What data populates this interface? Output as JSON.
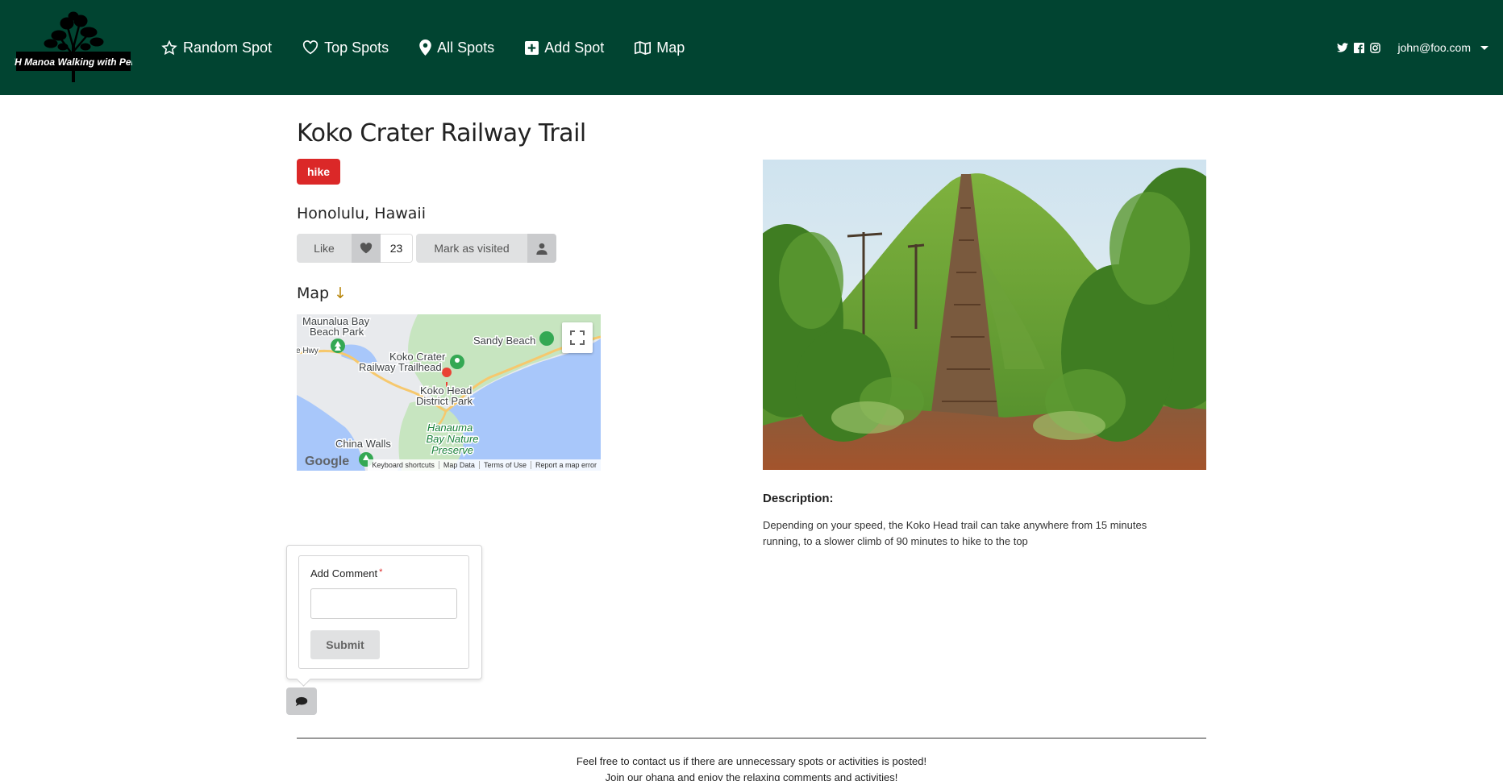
{
  "brand": {
    "logo_text": "UH Manoa Walking with Pele"
  },
  "nav": {
    "items": [
      {
        "label": "Random Spot",
        "icon": "star-icon"
      },
      {
        "label": "Top Spots",
        "icon": "heart-icon"
      },
      {
        "label": "All Spots",
        "icon": "map-marker-icon"
      },
      {
        "label": "Add Spot",
        "icon": "plus-square-icon"
      },
      {
        "label": "Map",
        "icon": "map-icon"
      }
    ],
    "social": [
      "twitter-icon",
      "facebook-icon",
      "instagram-icon"
    ],
    "user_email": "john@foo.com"
  },
  "spot": {
    "title": "Koko Crater Railway Trail",
    "tag": "hike",
    "location": "Honolulu, Hawaii",
    "like_label": "Like",
    "like_count": "23",
    "visit_label": "Mark as visited",
    "map_heading": "Map",
    "map_heading_arrow": "↓",
    "description_label": "Description:",
    "description": "Depending on your speed, the Koko Head trail can take anywhere from 15 minutes running, to a slower climb of 90 minutes to hike to the top"
  },
  "map": {
    "labels": {
      "maunalua": "Maunalua Bay",
      "maunalua2": "Beach Park",
      "sandy": "Sandy Beach",
      "koko_trail1": "Koko Crater",
      "koko_trail2": "Railway Trailhead",
      "koko_head1": "Koko Head",
      "koko_head2": "District Park",
      "hanauma1": "Hanauma",
      "hanauma2": "Bay Nature",
      "hanauma3": "Preserve",
      "china": "China Walls",
      "hwy": "e Hwy"
    },
    "google": "Google",
    "footer": [
      "Keyboard shortcuts",
      "Map Data",
      "Terms of Use",
      "Report a map error"
    ]
  },
  "comment": {
    "label": "Add Comment",
    "required_mark": "*",
    "submit": "Submit"
  },
  "footer": {
    "line1": "Feel free to contact us if there are unnecessary spots or activities is posted!",
    "line2": "Join our ohana and enjoy the relaxing comments and activities!"
  },
  "colors": {
    "navbar": "#014431",
    "tag": "#db2828"
  }
}
